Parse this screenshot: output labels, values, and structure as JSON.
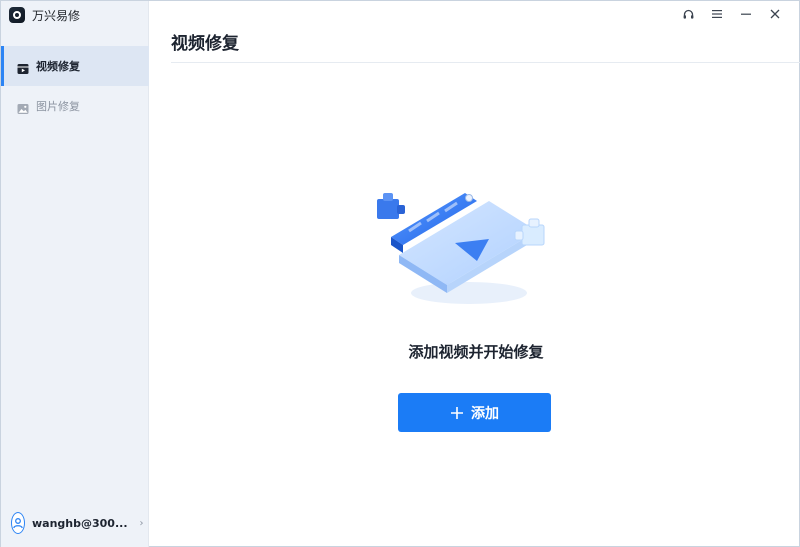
{
  "app": {
    "name": "万兴易修"
  },
  "sidebar": {
    "items": [
      {
        "label": "视频修复",
        "icon": "video-icon",
        "active": true
      },
      {
        "label": "图片修复",
        "icon": "image-icon",
        "active": false
      }
    ],
    "user": {
      "name": "wanghb@300...",
      "icon": "user-avatar-icon"
    }
  },
  "titlebar": {
    "buttons": [
      "headset-support-icon",
      "menu-icon",
      "minimize-icon",
      "close-icon"
    ]
  },
  "main": {
    "title": "视频修复",
    "headline": "添加视频并开始修复",
    "add_button": {
      "icon": "plus",
      "label": "添加"
    }
  },
  "colors": {
    "accent": "#1b7cf6",
    "sidebar_bg": "#eef2f8",
    "active_item_bg": "#dde6f3"
  }
}
